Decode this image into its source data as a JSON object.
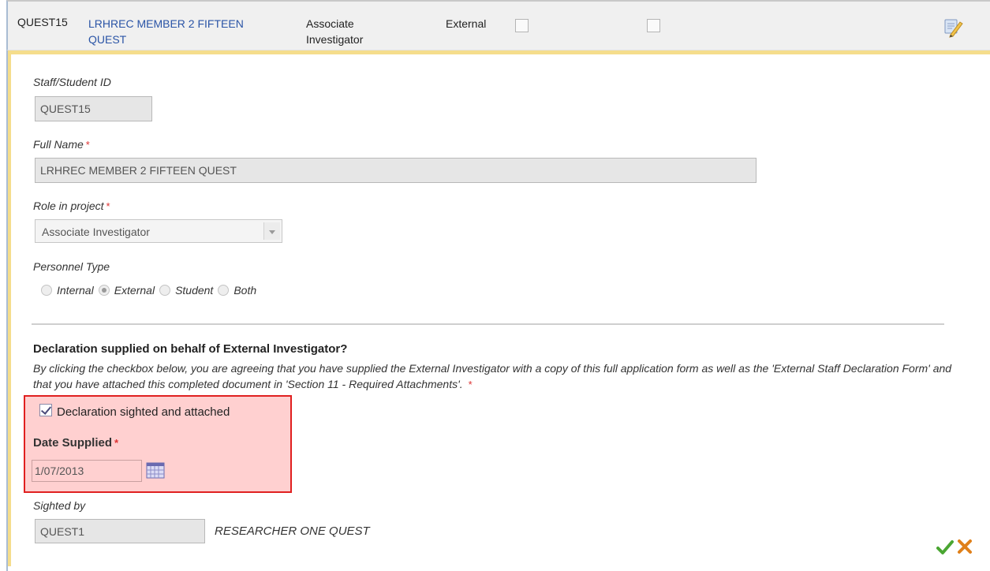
{
  "header": {
    "id": "QUEST15",
    "name_line1": "LRHREC MEMBER 2 FIFTEEN",
    "name_line2": "QUEST",
    "role_line1": "Associate",
    "role_line2": "Investigator",
    "external_label": "External",
    "edit_icon": "edit-pencil-icon"
  },
  "form": {
    "staff_id": {
      "label": "Staff/Student ID",
      "value": "QUEST15"
    },
    "full_name": {
      "label": "Full Name",
      "required": "*",
      "value": "LRHREC MEMBER 2 FIFTEEN QUEST"
    },
    "role": {
      "label": "Role in project",
      "required": "*",
      "value": "Associate Investigator"
    },
    "personnel_type": {
      "label": "Personnel Type",
      "options": [
        "Internal",
        "External",
        "Student",
        "Both"
      ],
      "selected": "External"
    },
    "declaration": {
      "title": "Declaration supplied on behalf of External Investigator?",
      "text": "By clicking the checkbox below, you are agreeing that you have supplied the External Investigator with a copy of this full application form as well as the 'External Staff Declaration Form' and that you have attached this completed document in 'Section 11 - Required Attachments'.",
      "required": "*",
      "checkbox_label": "Declaration sighted and attached",
      "checked": true
    },
    "date_supplied": {
      "label": "Date Supplied",
      "required": "*",
      "value": "1/07/2013"
    },
    "sighted_by": {
      "label": "Sighted by",
      "value": "QUEST1",
      "name": "RESEARCHER ONE QUEST"
    }
  },
  "colors": {
    "link": "#2a54a6",
    "highlight_bg": "#ffd0d0",
    "highlight_border": "#e02020",
    "accent_bar": "#f5dd8c"
  }
}
